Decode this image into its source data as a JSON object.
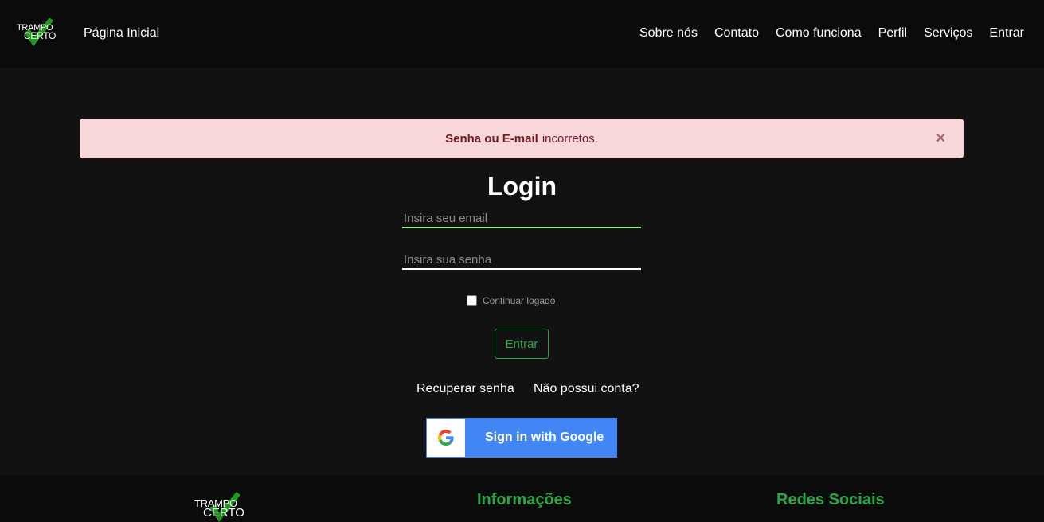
{
  "navbar": {
    "logo": {
      "line1": "TRAMPO",
      "line2": "CERTO"
    },
    "home": "Página Inicial",
    "links": [
      "Sobre nós",
      "Contato",
      "Como funciona",
      "Perfil",
      "Serviços",
      "Entrar"
    ]
  },
  "alert": {
    "strong": "Senha ou E-mail",
    "text": "incorretos.",
    "close": "×"
  },
  "login": {
    "title": "Login",
    "email_placeholder": "Insira seu email",
    "email_value": "",
    "password_placeholder": "Insira sua senha",
    "password_value": "",
    "remember_label": "Continuar logado",
    "remember_checked": false,
    "submit": "Entrar",
    "recover_link": "Recuperar senha",
    "register_link": "Não possui conta?",
    "google_button": "Sign in with Google"
  },
  "footer": {
    "logo": {
      "line1": "TRAMPO",
      "line2": "CERTO"
    },
    "info_heading": "Informações",
    "social_heading": "Redes Sociais"
  },
  "colors": {
    "background": "#121212",
    "navbar": "#0b0b0b",
    "accent_green": "#28a745",
    "alert_bg": "#f8d7da",
    "alert_text": "#721c24",
    "google_blue": "#4285f4"
  }
}
